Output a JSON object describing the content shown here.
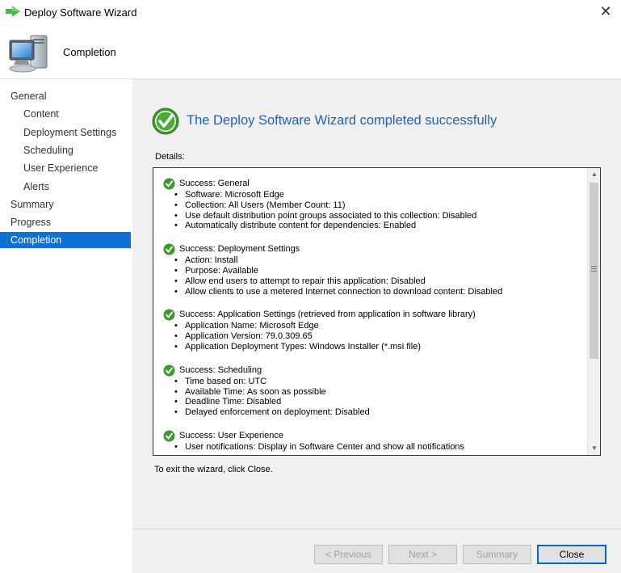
{
  "window": {
    "title": "Deploy Software Wizard",
    "close_glyph": "✕"
  },
  "banner": {
    "heading": "Completion"
  },
  "nav": {
    "items": [
      {
        "label": "General",
        "level": 0
      },
      {
        "label": "Content",
        "level": 1
      },
      {
        "label": "Deployment Settings",
        "level": 1
      },
      {
        "label": "Scheduling",
        "level": 1
      },
      {
        "label": "User Experience",
        "level": 1
      },
      {
        "label": "Alerts",
        "level": 1
      },
      {
        "label": "Summary",
        "level": 0
      },
      {
        "label": "Progress",
        "level": 0
      },
      {
        "label": "Completion",
        "level": 0,
        "active": true
      }
    ]
  },
  "main": {
    "success_title": "The Deploy Software Wizard completed successfully",
    "details_label": "Details:",
    "exit_text": "To exit the wizard, click Close."
  },
  "details": {
    "sections": [
      {
        "title": "Success: General",
        "items": [
          "Software: Microsoft Edge",
          "Collection: All Users (Member Count: 11)",
          "Use default distribution point groups associated to this collection: Disabled",
          "Automatically distribute content for dependencies: Enabled"
        ]
      },
      {
        "title": "Success: Deployment Settings",
        "items": [
          "Action: Install",
          "Purpose: Available",
          "Allow end users to attempt to repair this application: Disabled",
          "Allow clients to use a metered Internet connection to download content: Disabled"
        ]
      },
      {
        "title": "Success: Application Settings (retrieved from application in software library)",
        "items": [
          "Application Name: Microsoft Edge",
          "Application Version: 79.0.309.65",
          "Application Deployment Types: Windows Installer (*.msi file)"
        ]
      },
      {
        "title": "Success: Scheduling",
        "items": [
          "Time based on: UTC",
          "Available Time: As soon as possible",
          "Deadline Time: Disabled",
          "Delayed enforcement on deployment: Disabled"
        ]
      },
      {
        "title": "Success: User Experience",
        "items": [
          "User notifications: Display in Software Center and show all notifications"
        ]
      }
    ]
  },
  "buttons": {
    "previous": "< Previous",
    "next": "Next >",
    "summary": "Summary",
    "close": "Close"
  },
  "icons": {
    "window": "green-arrow-icon",
    "banner": "computer-icon",
    "success": "green-check-icon"
  },
  "colors": {
    "accent_nav": "#0f71d3",
    "title_blue": "#1e63b4",
    "success_green": "#3a9a2a"
  }
}
